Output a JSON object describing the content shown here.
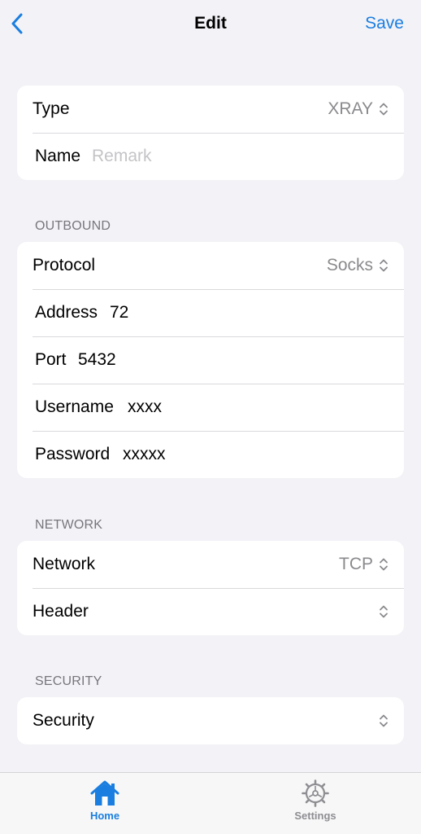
{
  "nav": {
    "back_icon": "chevron-left-icon",
    "title": "Edit",
    "save_label": "Save"
  },
  "general": {
    "type_label": "Type",
    "type_value": "XRAY",
    "name_label": "Name",
    "name_placeholder": "Remark"
  },
  "outbound": {
    "header": "OUTBOUND",
    "protocol_label": "Protocol",
    "protocol_value": "Socks",
    "address_label": "Address",
    "address_value": "72",
    "port_label": "Port",
    "port_value": "5432",
    "username_label": "Username",
    "username_value": "xxxx",
    "password_label": "Password",
    "password_value": "xxxxx"
  },
  "network": {
    "header": "NETWORK",
    "network_label": "Network",
    "network_value": "TCP",
    "header_label": "Header",
    "header_value": ""
  },
  "security": {
    "header": "SECURITY",
    "security_label": "Security",
    "security_value": ""
  },
  "tabbar": {
    "home_label": "Home",
    "home_icon": "house-icon",
    "settings_label": "Settings",
    "settings_icon": "gear-icon"
  },
  "colors": {
    "accent": "#1a7ee0",
    "background": "#f2f2f7",
    "secondary_text": "#8a8a8e",
    "inactive_tab": "#8e8e93"
  }
}
